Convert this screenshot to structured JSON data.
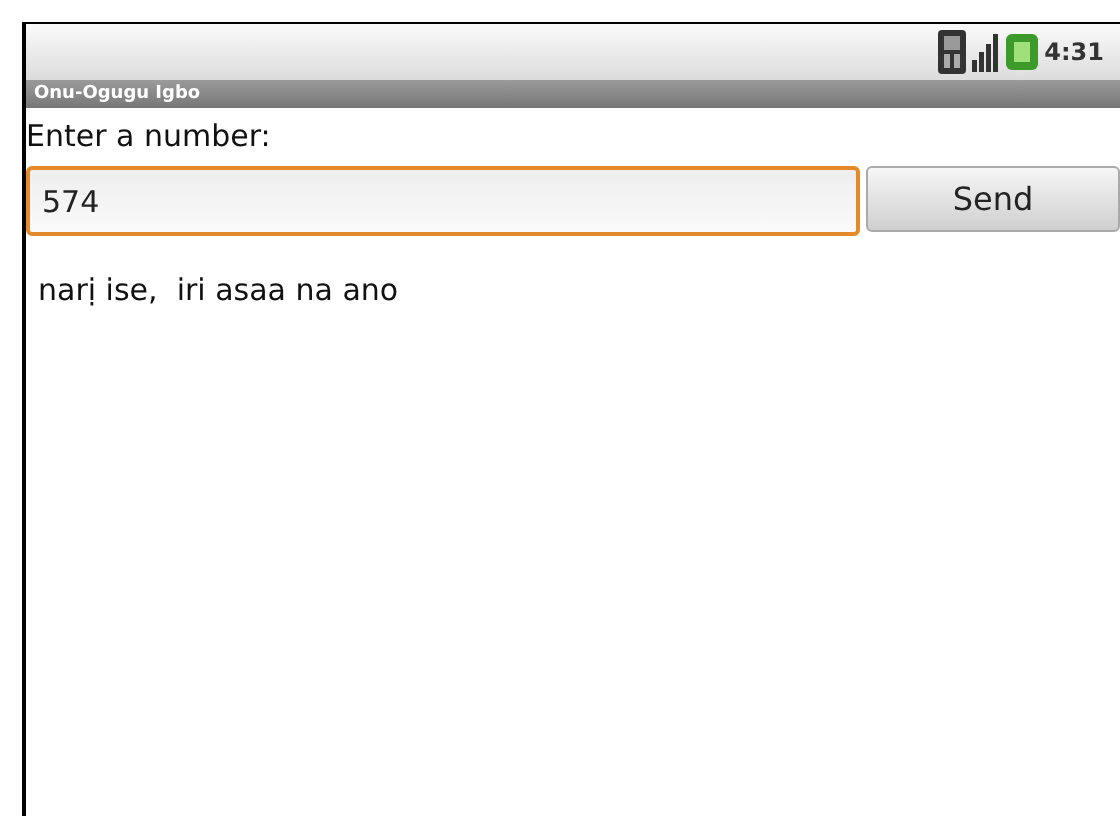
{
  "status_bar": {
    "time": "4:31"
  },
  "window": {
    "title": "Onu-Ogugu Igbo"
  },
  "prompt": "Enter a number:",
  "number_field": {
    "value": "574",
    "focused": true
  },
  "buttons": [
    "Send"
  ],
  "result": "narị ise,  iri asaa na ano"
}
